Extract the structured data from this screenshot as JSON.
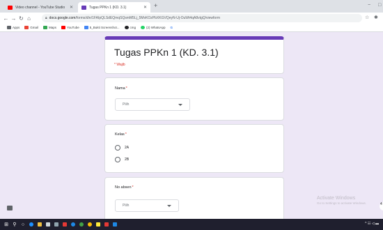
{
  "browser": {
    "tabs": [
      {
        "title": "Video channel - YouTube Studio",
        "favicon_color": "#ff0000"
      },
      {
        "title": "Tugas PPKn 1 (KD. 3.1)",
        "favicon_color": "#673ab7"
      }
    ],
    "new_tab": "+",
    "minimize": "−",
    "url_domain": "docs.google.com",
    "url_path": "/forms/d/e/1FAIpQLSdEQmqSQsmM5Lj_5MvKOzPbXKGVQeyN-Uj-OuWt4qA8vtgQ/viewform",
    "bookmarks": [
      {
        "label": "Apps",
        "color": "#5f6368"
      },
      {
        "label": "Gmail",
        "color": "#ea4335"
      },
      {
        "label": "Maps",
        "color": "#34a853"
      },
      {
        "label": "YouTube",
        "color": "#ff0000"
      },
      {
        "label": "5_Bukti Screenshot...",
        "color": "#4285f4"
      },
      {
        "label": "cmg",
        "color": "#202124"
      },
      {
        "label": "(2) WhatsApp",
        "color": "#25d366"
      },
      {
        "label": "G",
        "color": "#4285f4"
      }
    ]
  },
  "form": {
    "title": "Tugas PPKn 1 (KD. 3.1)",
    "required_note": "* Wajib",
    "accent": "#673ab7",
    "questions": [
      {
        "label": "Nama",
        "required": "*",
        "type": "dropdown",
        "placeholder": "Pilih"
      },
      {
        "label": "Kelas",
        "required": "*",
        "type": "radio",
        "options": [
          "2A",
          "2B"
        ]
      },
      {
        "label": "No absen",
        "required": "*",
        "type": "dropdown",
        "placeholder": "Pilih"
      }
    ]
  },
  "watermark": {
    "line1": "Activate Windows",
    "line2": "Go to Settings to activate Windows."
  },
  "side_chip": "4"
}
